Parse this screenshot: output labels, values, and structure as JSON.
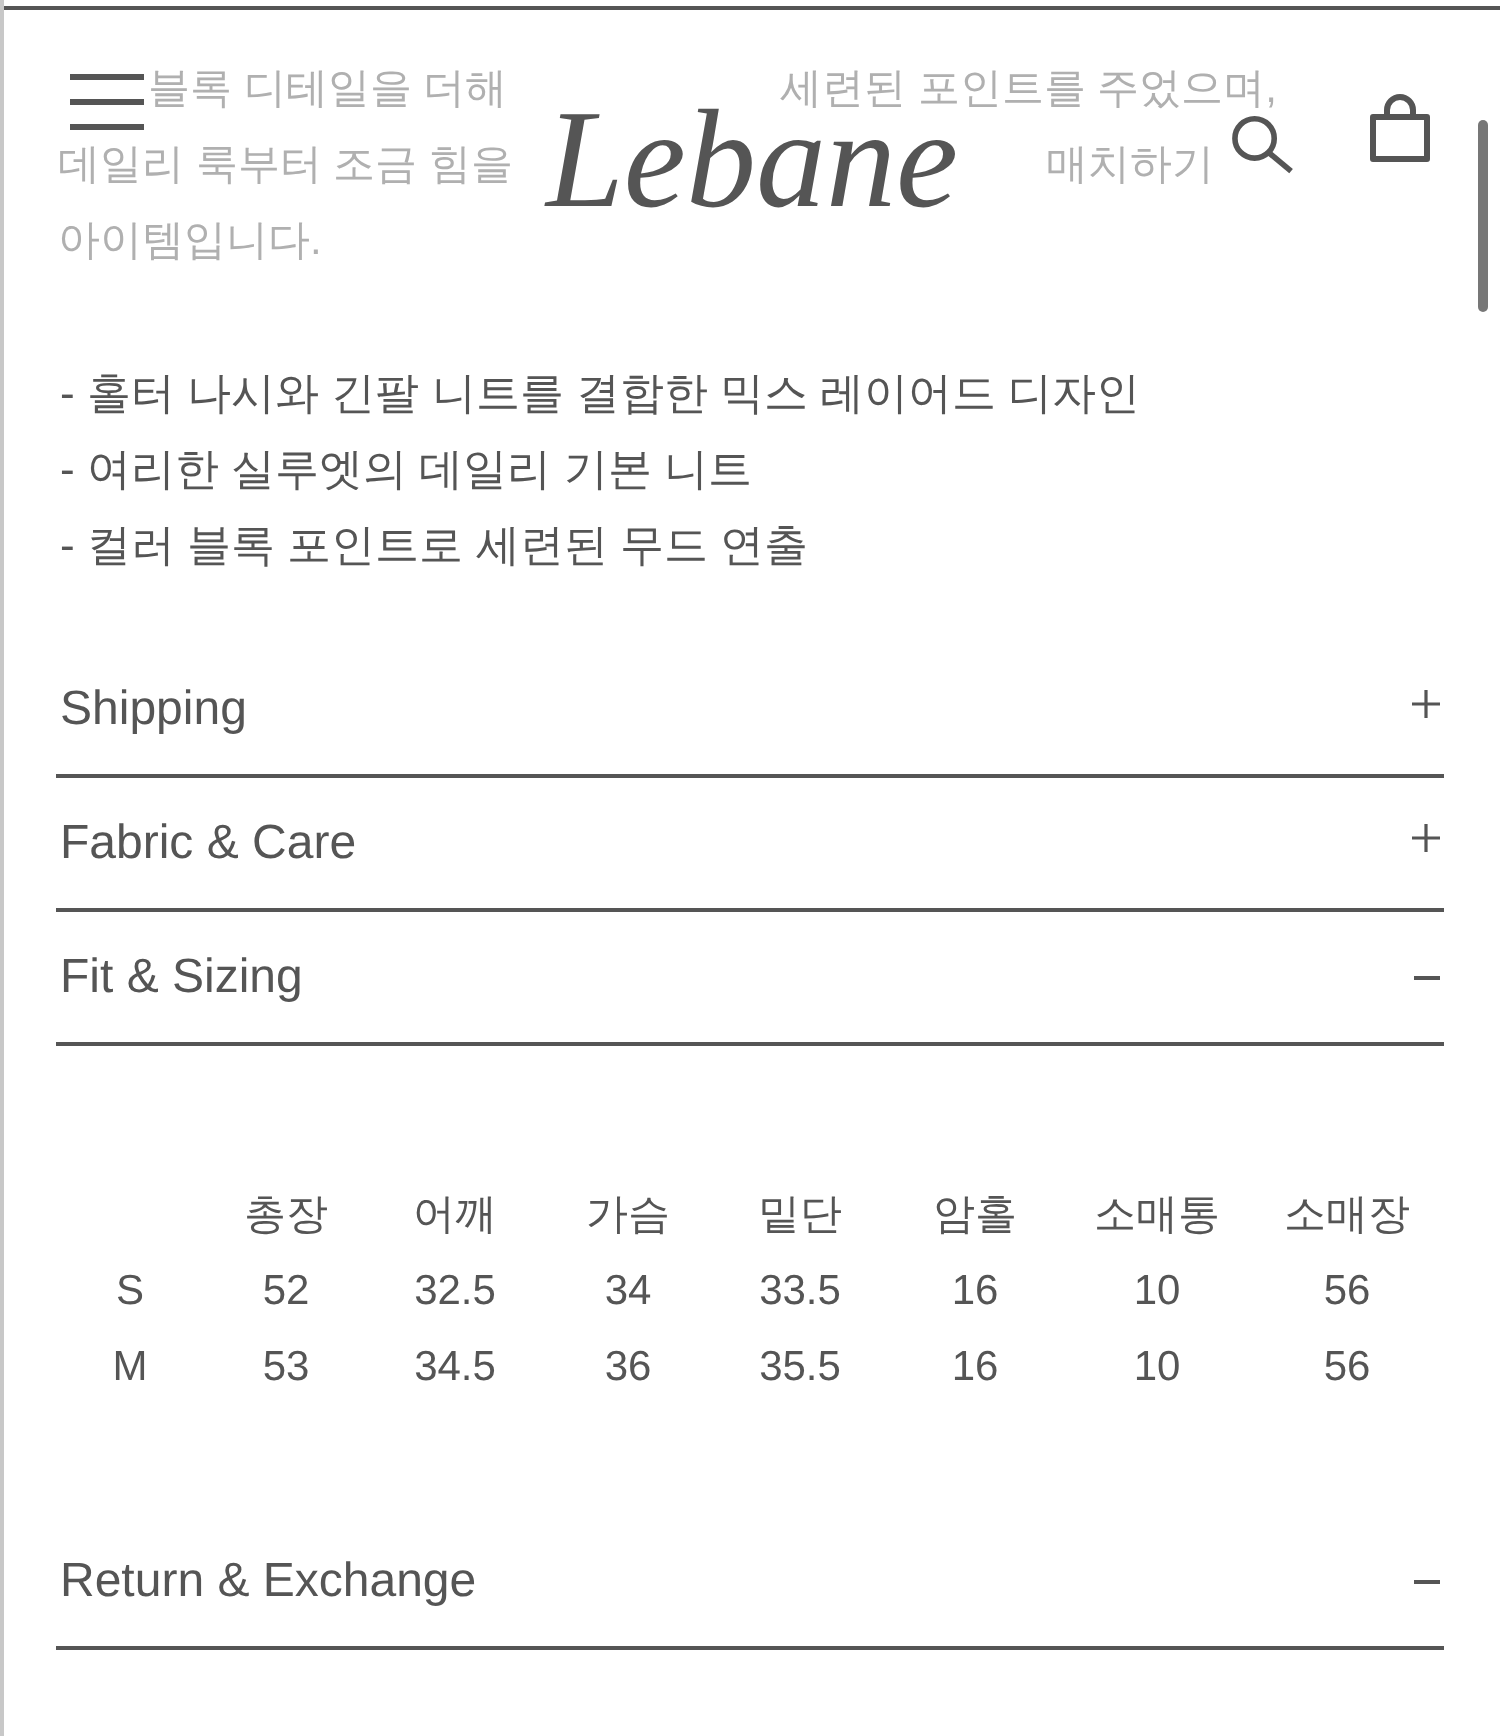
{
  "header": {
    "logo": "Lebane"
  },
  "faded_text": [
    {
      "fragments": [
        "블록 디테일을 더해",
        "세련된 포인트를 주었으며,"
      ]
    },
    {
      "fragments": [
        "데일리 룩부터 조금 힘을",
        "매치하기"
      ]
    },
    {
      "fragments": [
        "아이템입니다."
      ]
    }
  ],
  "bullets": [
    "- 홀터 나시와 긴팔 니트를 결합한 믹스 레이어드 디자인",
    "- 여리한 실루엣의 데일리 기본 니트",
    "- 컬러 블록 포인트로 세련된 무드 연출"
  ],
  "accordion": [
    {
      "title": "Shipping",
      "expanded": false
    },
    {
      "title": "Fabric & Care",
      "expanded": false
    },
    {
      "title": "Fit & Sizing",
      "expanded": true,
      "size_table": {
        "columns": [
          "총장",
          "어깨",
          "가슴",
          "밑단",
          "암홀",
          "소매통",
          "소매장"
        ],
        "rows": [
          {
            "size": "S",
            "values": [
              "52",
              "32.5",
              "34",
              "33.5",
              "16",
              "10",
              "56"
            ]
          },
          {
            "size": "M",
            "values": [
              "53",
              "34.5",
              "36",
              "35.5",
              "16",
              "10",
              "56"
            ]
          }
        ]
      }
    },
    {
      "title": "Return & Exchange",
      "expanded": true
    }
  ]
}
